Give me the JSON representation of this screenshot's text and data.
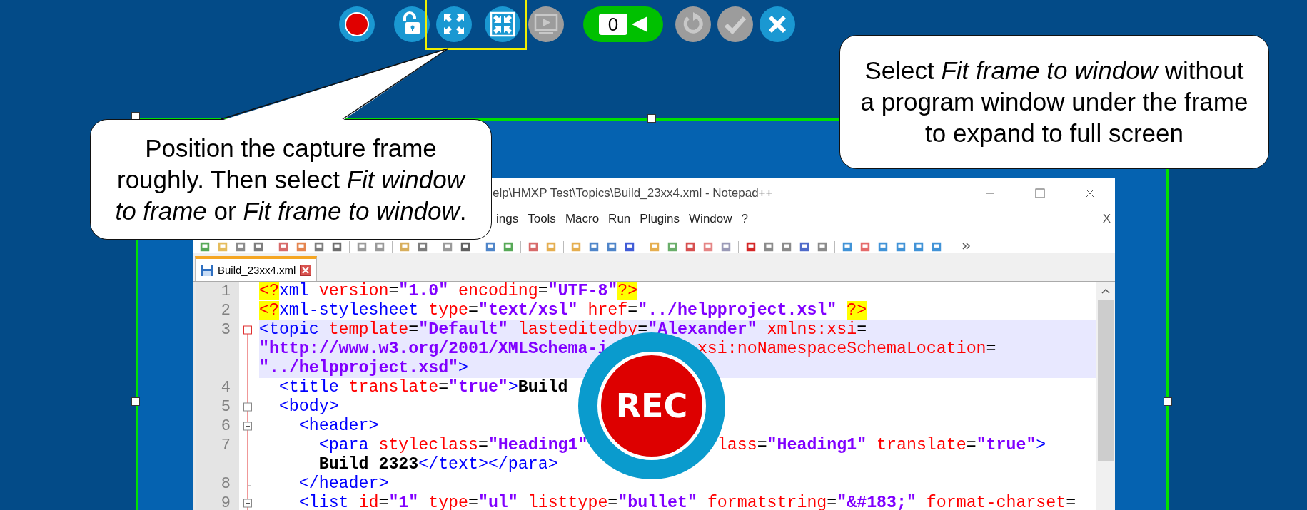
{
  "toolbar": {
    "groups": [
      {
        "highlighted": false,
        "buttons": [
          {
            "kind": "record",
            "disabled": false
          },
          {
            "kind": "unlock",
            "disabled": false
          }
        ]
      },
      {
        "highlighted": true,
        "buttons": [
          {
            "kind": "fit-frame",
            "disabled": false
          },
          {
            "kind": "fit-window",
            "disabled": false
          }
        ]
      },
      {
        "highlighted": false,
        "buttons": [
          {
            "kind": "preview",
            "disabled": true
          },
          {
            "kind": "counter",
            "label": "0",
            "disabled": false
          },
          {
            "kind": "undo",
            "disabled": true
          },
          {
            "kind": "confirm",
            "disabled": true
          },
          {
            "kind": "cancel",
            "disabled": false
          }
        ]
      }
    ]
  },
  "callouts": [
    {
      "text": "Position the capture frame roughly. Then select *Fit window to frame* or *Fit frame to window*.",
      "tail": true
    },
    {
      "text": "Select *Fit frame to window* without a program window under the frame to expand to full screen",
      "tail": false
    }
  ],
  "editor_window": {
    "title": "elp\\HMXP Test\\Topics\\Build_23xx4.xml - Notepad++",
    "menu": [
      "ings",
      "Tools",
      "Macro",
      "Run",
      "Plugins",
      "Window",
      "?"
    ],
    "menu_close": "X",
    "tabs": [
      {
        "label": "Build_23xx4.xml",
        "selected": true
      }
    ],
    "lines": [
      {
        "number": "1",
        "current": false,
        "tokens": [
          {
            "kind": "pi",
            "text": "<?"
          },
          {
            "kind": "tag",
            "text": "xml"
          },
          {
            "kind": "attr",
            "text": " version"
          },
          {
            "kind": "plain",
            "text": "="
          },
          {
            "kind": "value",
            "text": "\"1.0\""
          },
          {
            "kind": "attr",
            "text": " encoding"
          },
          {
            "kind": "plain",
            "text": "="
          },
          {
            "kind": "value",
            "text": "\"UTF-8\""
          },
          {
            "kind": "pi",
            "text": "?>"
          }
        ]
      },
      {
        "number": "2",
        "current": false,
        "tokens": [
          {
            "kind": "pi",
            "text": "<?"
          },
          {
            "kind": "tag",
            "text": "xml-stylesheet"
          },
          {
            "kind": "attr",
            "text": " type"
          },
          {
            "kind": "plain",
            "text": "="
          },
          {
            "kind": "value",
            "text": "\"text/xsl\""
          },
          {
            "kind": "attr",
            "text": " href"
          },
          {
            "kind": "plain",
            "text": "="
          },
          {
            "kind": "value",
            "text": "\"../helpproject.xsl\" "
          },
          {
            "kind": "pi",
            "text": "?>"
          }
        ]
      },
      {
        "number": "3",
        "kind": "fold-root",
        "current": true,
        "tokens": [
          {
            "kind": "tag",
            "text": "<topic"
          },
          {
            "kind": "attr",
            "text": " template"
          },
          {
            "kind": "plain",
            "text": "="
          },
          {
            "kind": "value",
            "text": "\"Default\""
          },
          {
            "kind": "attr",
            "text": " lasteditedby"
          },
          {
            "kind": "plain",
            "text": "="
          },
          {
            "kind": "value",
            "text": "\"Alexander\""
          },
          {
            "kind": "attr",
            "text": " xmlns:xsi"
          },
          {
            "kind": "plain",
            "text": "="
          }
        ]
      },
      {
        "kind": "fold-line",
        "current": true,
        "tokens": [
          {
            "kind": "value",
            "text": "\"http://www.w3.org/2001/XMLSchema-i"
          },
          {
            "kind": "attr",
            "text": "         xsi:noNamespaceSchemaLocation"
          },
          {
            "kind": "plain",
            "text": "="
          }
        ]
      },
      {
        "kind": "fold-line",
        "current": true,
        "tokens": [
          {
            "kind": "value",
            "text": "\"../helpproject.xsd\""
          },
          {
            "kind": "tag",
            "text": ">"
          }
        ]
      },
      {
        "number": "4",
        "kind": "fold-line",
        "current": false,
        "tokens": [
          {
            "kind": "tag",
            "text": "  <title"
          },
          {
            "kind": "attr",
            "text": " translate"
          },
          {
            "kind": "plain",
            "text": "="
          },
          {
            "kind": "value",
            "text": "\"true\""
          },
          {
            "kind": "tag",
            "text": ">"
          },
          {
            "kind": "text",
            "text": "Build"
          }
        ]
      },
      {
        "number": "5",
        "kind": "fold-open",
        "current": false,
        "tokens": [
          {
            "kind": "tag",
            "text": "  <body>"
          }
        ]
      },
      {
        "number": "6",
        "kind": "fold-open",
        "current": false,
        "tokens": [
          {
            "kind": "tag",
            "text": "    <header>"
          }
        ]
      },
      {
        "number": "7",
        "kind": "fold-line",
        "current": false,
        "tokens": [
          {
            "kind": "tag",
            "text": "      <para"
          },
          {
            "kind": "attr",
            "text": " styleclass"
          },
          {
            "kind": "plain",
            "text": "="
          },
          {
            "kind": "value",
            "text": "\"Heading1\""
          },
          {
            "kind": "attr",
            "text": "             lass"
          },
          {
            "kind": "plain",
            "text": "="
          },
          {
            "kind": "value",
            "text": "\"Heading1\""
          },
          {
            "kind": "attr",
            "text": " translate"
          },
          {
            "kind": "plain",
            "text": "="
          },
          {
            "kind": "value",
            "text": "\"true\""
          },
          {
            "kind": "tag",
            "text": ">"
          }
        ]
      },
      {
        "kind": "fold-line",
        "current": false,
        "tokens": [
          {
            "kind": "text",
            "text": "      Build 2323"
          },
          {
            "kind": "tag",
            "text": "</text></para>"
          }
        ]
      },
      {
        "number": "8",
        "kind": "fold-end",
        "current": false,
        "tokens": [
          {
            "kind": "tag",
            "text": "    </header>"
          }
        ]
      },
      {
        "number": "9",
        "kind": "fold-open",
        "current": false,
        "tokens": [
          {
            "kind": "tag",
            "text": "    <list"
          },
          {
            "kind": "attr",
            "text": " id"
          },
          {
            "kind": "plain",
            "text": "="
          },
          {
            "kind": "value",
            "text": "\"1\""
          },
          {
            "kind": "attr",
            "text": " type"
          },
          {
            "kind": "plain",
            "text": "="
          },
          {
            "kind": "value",
            "text": "\"ul\""
          },
          {
            "kind": "attr",
            "text": " listtype"
          },
          {
            "kind": "plain",
            "text": "="
          },
          {
            "kind": "value",
            "text": "\"bullet\""
          },
          {
            "kind": "attr",
            "text": " formatstring"
          },
          {
            "kind": "plain",
            "text": "="
          },
          {
            "kind": "value",
            "text": "\"&#183;\""
          },
          {
            "kind": "attr",
            "text": " format-charset"
          },
          {
            "kind": "plain",
            "text": "="
          }
        ]
      }
    ]
  },
  "rec_badge": {
    "label": "REC"
  }
}
